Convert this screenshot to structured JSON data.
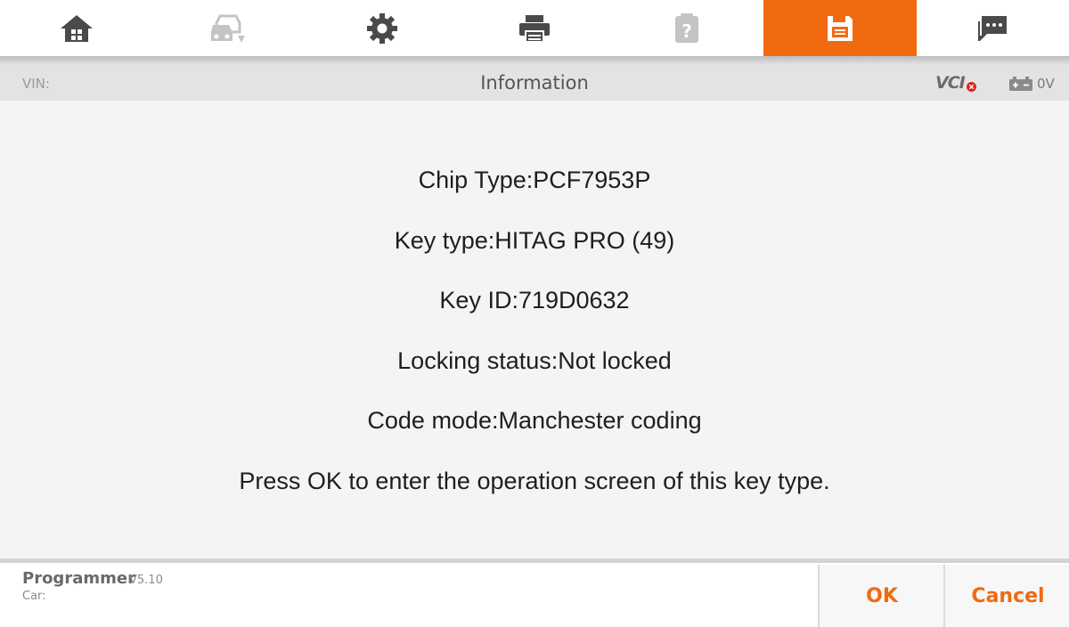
{
  "toolbar": {
    "items": [
      {
        "icon": "home-icon",
        "active": false
      },
      {
        "icon": "car-switch-icon",
        "active": false,
        "disabled": true
      },
      {
        "icon": "gear-icon",
        "active": false
      },
      {
        "icon": "printer-icon",
        "active": false
      },
      {
        "icon": "help-icon",
        "active": false,
        "disabled": true
      },
      {
        "icon": "save-icon",
        "active": true
      },
      {
        "icon": "chat-icon",
        "active": false
      }
    ],
    "accent_color": "#f26a10"
  },
  "statusbar": {
    "vin_label": "VIN:",
    "title": "Information",
    "vci_label": "VCI",
    "voltage": "0V"
  },
  "content": {
    "lines": [
      "Chip Type:PCF7953P",
      "Key type:HITAG PRO (49)",
      "Key ID:719D0632",
      "Locking status:Not locked",
      "Code mode:Manchester coding",
      "Press OK to enter the operation screen of this key type."
    ]
  },
  "footer": {
    "app_name": "Programmer",
    "version": "V5.10",
    "car_label": "Car:",
    "ok_label": "OK",
    "cancel_label": "Cancel"
  }
}
